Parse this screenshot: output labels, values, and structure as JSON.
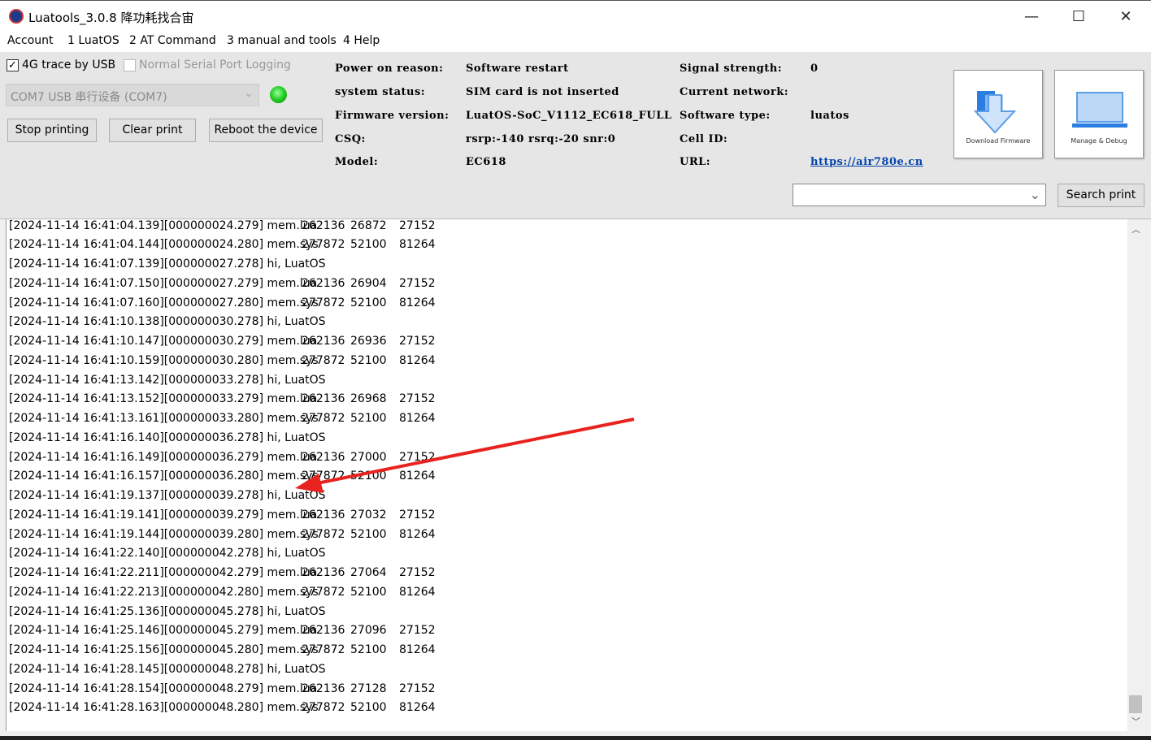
{
  "window": {
    "title": "Luatools_3.0.8 降功耗找合宙",
    "minimize": "—",
    "maximize": "☐",
    "close": "✕"
  },
  "menu": [
    "Account",
    "1 LuatOS",
    "2 AT Command",
    "3 manual and tools",
    "4 Help"
  ],
  "options": {
    "trace_usb": {
      "label": "4G trace by USB",
      "checked": true
    },
    "serial_logging": {
      "label": "Normal Serial Port Logging",
      "checked": false
    }
  },
  "port": {
    "selected": "COM7 USB 串行设备 (COM7)",
    "status_color": "#22cc22"
  },
  "buttons": {
    "stop": "Stop printing",
    "clear": "Clear print",
    "reboot": "Reboot the device",
    "download": "Download Firmware",
    "manage": "Manage & Debug",
    "search": "Search print"
  },
  "info": {
    "power_on_reason": {
      "label": "Power on reason:",
      "value": "Software restart"
    },
    "system_status": {
      "label": "system status:",
      "value": "SIM card is not inserted"
    },
    "firmware": {
      "label": "Firmware version:",
      "value": "LuatOS-SoC_V1112_EC618_FULL"
    },
    "csq": {
      "label": "CSQ:",
      "value": "rsrp:-140 rsrq:-20 snr:0"
    },
    "model": {
      "label": "Model:",
      "value": "EC618"
    },
    "signal": {
      "label": "Signal strength:",
      "value": "0"
    },
    "network": {
      "label": "Current network:",
      "value": ""
    },
    "software_type": {
      "label": "Software type:",
      "value": "luatos"
    },
    "cell_id": {
      "label": "Cell ID:",
      "value": ""
    },
    "url": {
      "label": "URL:",
      "value": "https://air780e.cn"
    }
  },
  "search": {
    "value": ""
  },
  "log": [
    [
      "[2024-11-14 16:41:04.139][000000024.279] mem.lua",
      "262136",
      "26872",
      "27152"
    ],
    [
      "[2024-11-14 16:41:04.144][000000024.280] mem.sys",
      "277872",
      "52100",
      "81264"
    ],
    [
      "[2024-11-14 16:41:07.139][000000027.278] hi, LuatOS",
      "",
      "",
      ""
    ],
    [
      "[2024-11-14 16:41:07.150][000000027.279] mem.lua",
      "262136",
      "26904",
      "27152"
    ],
    [
      "[2024-11-14 16:41:07.160][000000027.280] mem.sys",
      "277872",
      "52100",
      "81264"
    ],
    [
      "[2024-11-14 16:41:10.138][000000030.278] hi, LuatOS",
      "",
      "",
      ""
    ],
    [
      "[2024-11-14 16:41:10.147][000000030.279] mem.lua",
      "262136",
      "26936",
      "27152"
    ],
    [
      "[2024-11-14 16:41:10.159][000000030.280] mem.sys",
      "277872",
      "52100",
      "81264"
    ],
    [
      "[2024-11-14 16:41:13.142][000000033.278] hi, LuatOS",
      "",
      "",
      ""
    ],
    [
      "[2024-11-14 16:41:13.152][000000033.279] mem.lua",
      "262136",
      "26968",
      "27152"
    ],
    [
      "[2024-11-14 16:41:13.161][000000033.280] mem.sys",
      "277872",
      "52100",
      "81264"
    ],
    [
      "[2024-11-14 16:41:16.140][000000036.278] hi, LuatOS",
      "",
      "",
      ""
    ],
    [
      "[2024-11-14 16:41:16.149][000000036.279] mem.lua",
      "262136",
      "27000",
      "27152"
    ],
    [
      "[2024-11-14 16:41:16.157][000000036.280] mem.sys",
      "277872",
      "52100",
      "81264"
    ],
    [
      "[2024-11-14 16:41:19.137][000000039.278] hi, LuatOS",
      "",
      "",
      ""
    ],
    [
      "[2024-11-14 16:41:19.141][000000039.279] mem.lua",
      "262136",
      "27032",
      "27152"
    ],
    [
      "[2024-11-14 16:41:19.144][000000039.280] mem.sys",
      "277872",
      "52100",
      "81264"
    ],
    [
      "[2024-11-14 16:41:22.140][000000042.278] hi, LuatOS",
      "",
      "",
      ""
    ],
    [
      "[2024-11-14 16:41:22.211][000000042.279] mem.lua",
      "262136",
      "27064",
      "27152"
    ],
    [
      "[2024-11-14 16:41:22.213][000000042.280] mem.sys",
      "277872",
      "52100",
      "81264"
    ],
    [
      "[2024-11-14 16:41:25.136][000000045.278] hi, LuatOS",
      "",
      "",
      ""
    ],
    [
      "[2024-11-14 16:41:25.146][000000045.279] mem.lua",
      "262136",
      "27096",
      "27152"
    ],
    [
      "[2024-11-14 16:41:25.156][000000045.280] mem.sys",
      "277872",
      "52100",
      "81264"
    ],
    [
      "[2024-11-14 16:41:28.145][000000048.278] hi, LuatOS",
      "",
      "",
      ""
    ],
    [
      "[2024-11-14 16:41:28.154][000000048.279] mem.lua",
      "262136",
      "27128",
      "27152"
    ],
    [
      "[2024-11-14 16:41:28.163][000000048.280] mem.sys",
      "277872",
      "52100",
      "81264"
    ]
  ],
  "annotation": {
    "arrow_color": "#e8231f"
  }
}
